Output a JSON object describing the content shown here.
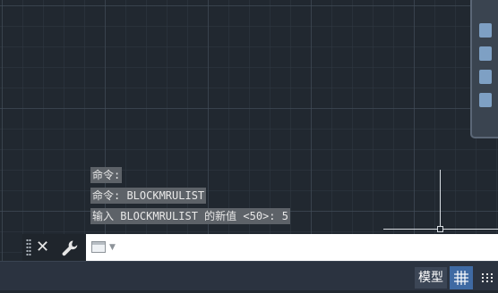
{
  "command_history": [
    "命令:",
    "命令: BLOCKMRULIST",
    "输入 BLOCKMRULIST 的新值 <50>: 5"
  ],
  "command_line": {
    "input_value": "",
    "close_icon": "close-icon",
    "customize_icon": "wrench-icon",
    "prompt_icon": "command-prompt-icon"
  },
  "statusbar": {
    "model_tab_label": "模型",
    "grid_icon": "grid-icon",
    "snap_icon": "snap-grid-icon"
  },
  "colors": {
    "canvas_background": "#212830",
    "grid_active": "#3f6aa3",
    "history_highlight": "#5d6268"
  }
}
